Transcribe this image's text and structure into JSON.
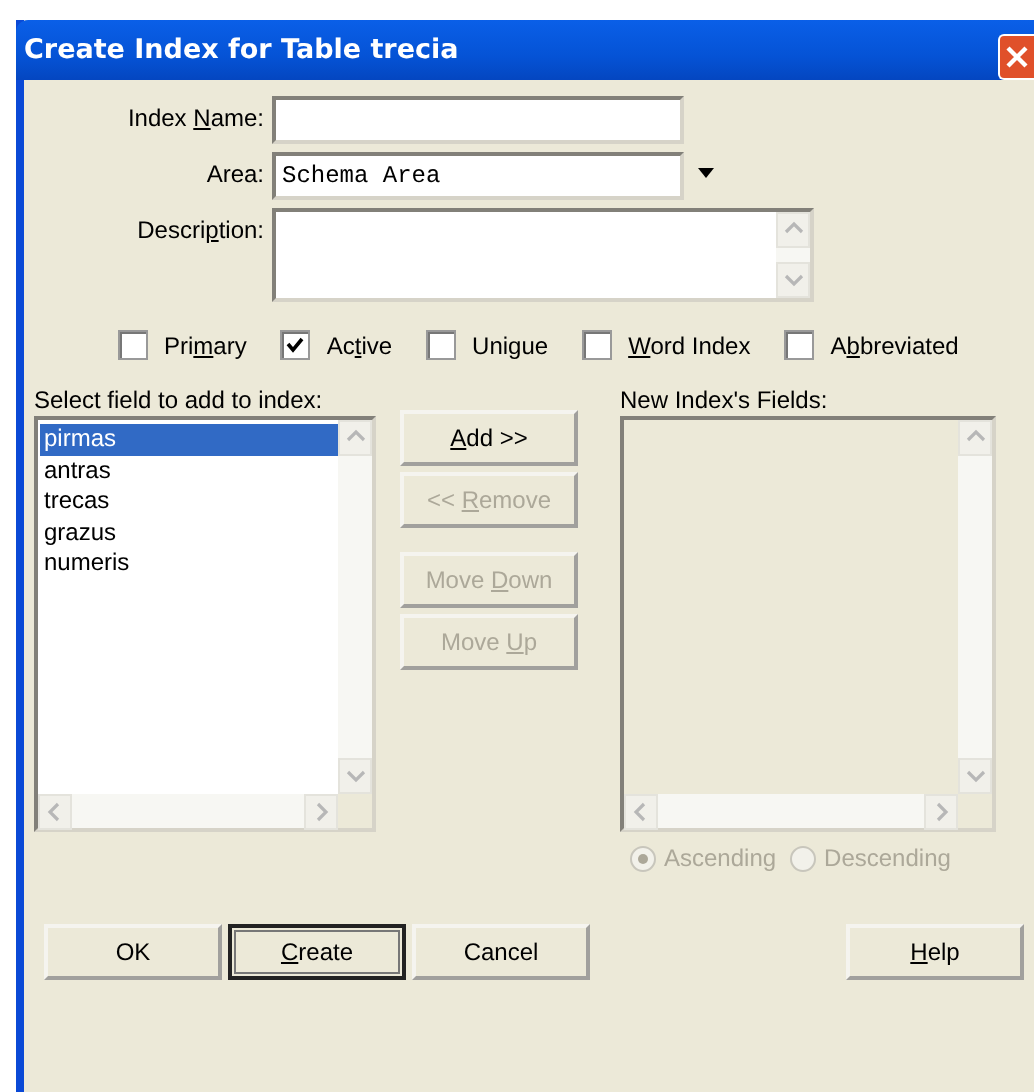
{
  "window": {
    "title": "Create Index for Table trecia"
  },
  "form": [
    {
      "kind": "text",
      "label": {
        "pre": "Index ",
        "key": "N",
        "post": "ame:"
      }
    },
    {
      "kind": "combo",
      "label": {
        "pre": "Area:"
      },
      "value": "Schema Area"
    },
    {
      "kind": "memo",
      "label": {
        "pre": "Descri",
        "key": "p",
        "post": "tion:"
      }
    }
  ],
  "options": [
    {
      "label": {
        "pre": "Pri",
        "key": "m",
        "post": "ary"
      },
      "checked": false
    },
    {
      "label": {
        "pre": "Ac",
        "key": "t",
        "post": "ive"
      },
      "checked": true
    },
    {
      "label": {
        "pre": "Unigue"
      },
      "checked": false
    },
    {
      "label": {
        "key": "W",
        "post": "ord Index"
      },
      "checked": false
    },
    {
      "label": {
        "pre": "A",
        "key": "b",
        "post": "breviated"
      },
      "checked": false
    }
  ],
  "source_list": {
    "label": "Select field to add to index:",
    "items": [
      {
        "text": "pirmas",
        "selected": true
      },
      {
        "text": "antras",
        "selected": false
      },
      {
        "text": "trecas",
        "selected": false
      },
      {
        "text": "grazus",
        "selected": false
      },
      {
        "text": "numeris",
        "selected": false
      }
    ]
  },
  "action_groups": [
    {
      "buttons": [
        {
          "label": {
            "key": "A",
            "post": "dd >>"
          },
          "disabled": false
        },
        {
          "label": {
            "pre": "<< ",
            "key": "R",
            "post": "emove"
          },
          "disabled": true
        }
      ]
    },
    {
      "buttons": [
        {
          "label": {
            "pre": "Move ",
            "key": "D",
            "post": "own"
          },
          "disabled": true
        },
        {
          "label": {
            "pre": "Move ",
            "key": "U",
            "post": "p"
          },
          "disabled": true
        }
      ]
    }
  ],
  "target_list": {
    "label": "New Index's Fields:",
    "disabled": true
  },
  "sort_order": [
    {
      "label": "Ascending",
      "selected": true,
      "disabled": true
    },
    {
      "label": "Descending",
      "selected": false,
      "disabled": true
    }
  ],
  "buttons": [
    {
      "label": {
        "pre": "OK"
      },
      "default": false
    },
    {
      "label": {
        "key": "C",
        "post": "reate"
      },
      "default": true
    },
    {
      "label": {
        "pre": "Cancel"
      },
      "default": false
    },
    {
      "label": {
        "key": "H",
        "post": "elp"
      },
      "default": false
    }
  ]
}
